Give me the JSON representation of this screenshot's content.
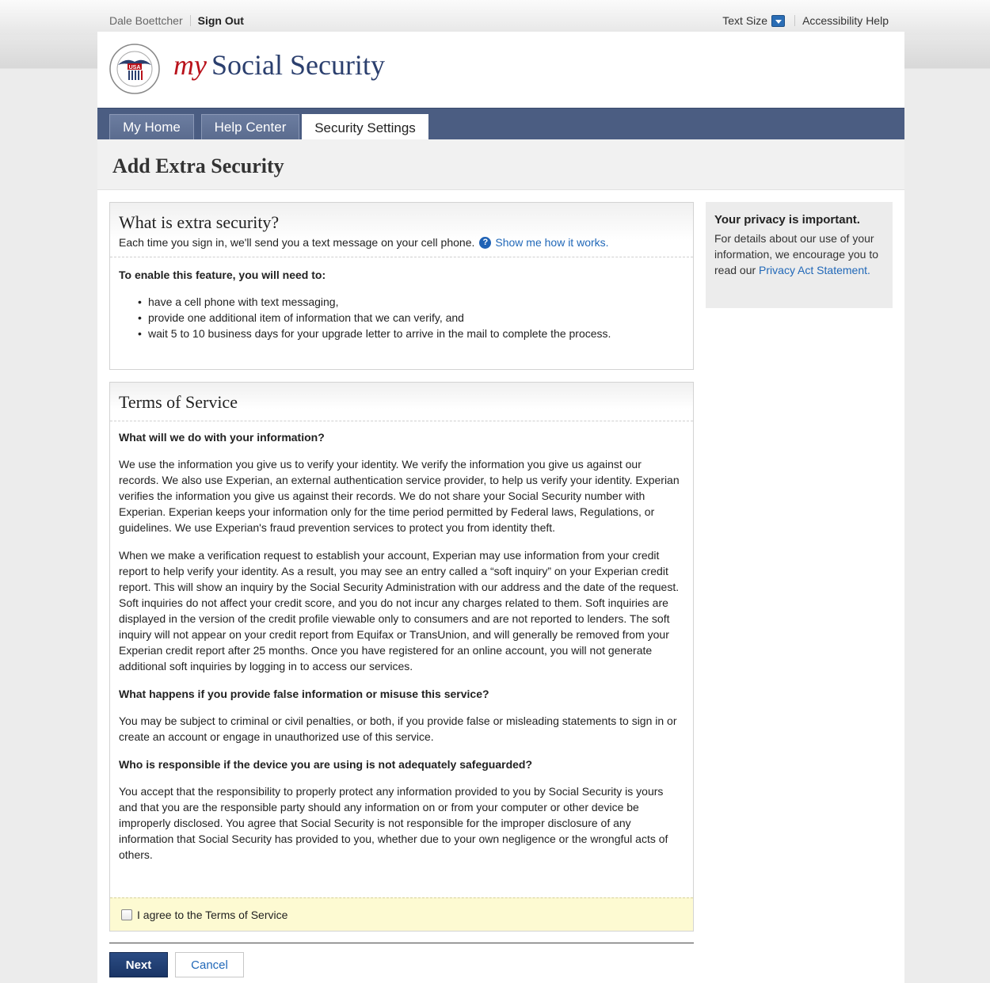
{
  "topbar": {
    "user_name": "Dale Boettcher",
    "sign_out": "Sign Out",
    "text_size": "Text Size",
    "accessibility_help": "Accessibility Help"
  },
  "logo": {
    "my": "my",
    "rest": "Social Security",
    "seal_text": "USA"
  },
  "nav": {
    "tabs": [
      {
        "label": "My Home"
      },
      {
        "label": "Help Center"
      },
      {
        "label": "Security Settings"
      }
    ]
  },
  "page_title": "Add Extra Security",
  "extra": {
    "title": "What is extra security?",
    "intro": "Each time you sign in, we'll send you a text message on your cell phone.",
    "help_icon": "?",
    "show_link": "Show me how it works.",
    "need_heading": "To enable this feature, you will need to:",
    "items": [
      "have a cell phone with text messaging,",
      "provide one additional item of information that we can verify, and",
      "wait 5 to 10 business days for your upgrade letter to arrive in the mail to complete the process."
    ]
  },
  "tos": {
    "title": "Terms of Service",
    "q1": "What will we do with your information?",
    "p1": "We use the information you give us to verify your identity. We verify the information you give us against our records. We also use Experian, an external authentication service provider, to help us verify your identity. Experian verifies the information you give us against their records. We do not share your Social Security number with Experian. Experian keeps your information only for the time period permitted by Federal laws, Regulations, or guidelines. We use Experian's fraud prevention services to protect you from identity theft.",
    "p2": "When we make a verification request to establish your account, Experian may use information from your credit report to help verify your identity. As a result, you may see an entry called a “soft inquiry” on your Experian credit report. This will show an inquiry by the Social Security Administration with our address and the date of the request. Soft inquiries do not affect your credit score, and you do not incur any charges related to them. Soft inquiries are displayed in the version of the credit profile viewable only to consumers and are not reported to lenders. The soft inquiry will not appear on your credit report from Equifax or TransUnion, and will generally be removed from your Experian credit report after 25 months. Once you have registered for an online account, you will not generate additional soft inquiries by logging in to access our services.",
    "q2": "What happens if you provide false information or misuse this service?",
    "p3": "You may be subject to criminal or civil penalties, or both, if you provide false or misleading statements to sign in or create an account or engage in unauthorized use of this service.",
    "q3": "Who is responsible if the device you are using is not adequately safeguarded?",
    "p4": "You accept that the responsibility to properly protect any information provided to you by Social Security is yours and that you are the responsible party should any information on or from your computer or other device be improperly disclosed. You agree that Social Security is not responsible for the improper disclosure of any information that Social Security has provided to you, whether due to your own negligence or the wrongful acts of others.",
    "agree_label": "I agree to the Terms of Service"
  },
  "actions": {
    "next": "Next",
    "cancel": "Cancel"
  },
  "sidebar": {
    "title": "Your privacy is important.",
    "text": "For details about our use of your information, we encourage you to read our",
    "link": "Privacy Act Statement."
  }
}
